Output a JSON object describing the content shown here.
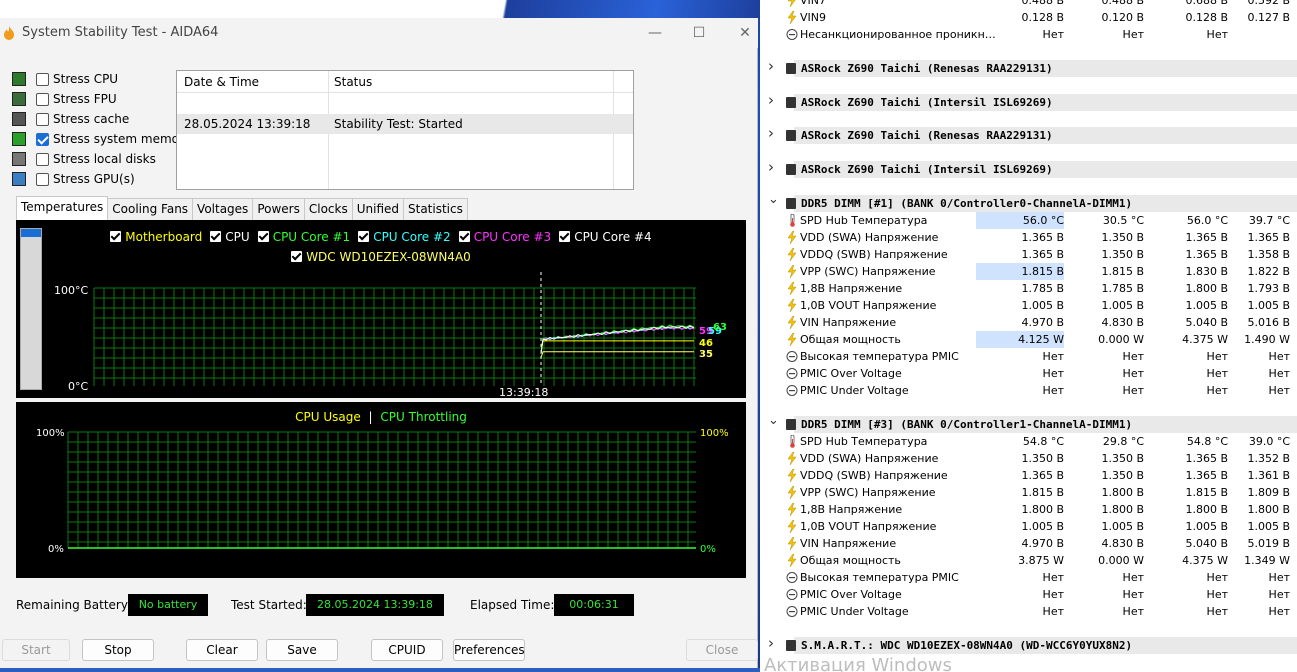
{
  "window": {
    "title": "System Stability Test - AIDA64",
    "minimize": "—",
    "maximize": "☐",
    "close": "✕"
  },
  "stress_options": [
    {
      "label": "Stress CPU",
      "checked": false
    },
    {
      "label": "Stress FPU",
      "checked": false
    },
    {
      "label": "Stress cache",
      "checked": false
    },
    {
      "label": "Stress system memory",
      "checked": true
    },
    {
      "label": "Stress local disks",
      "checked": false
    },
    {
      "label": "Stress GPU(s)",
      "checked": false
    }
  ],
  "log": {
    "headers": [
      "Date & Time",
      "Status"
    ],
    "rows": [
      {
        "datetime": "28.05.2024 13:39:18",
        "status": "Stability Test: Started"
      }
    ]
  },
  "tabs": [
    "Temperatures",
    "Cooling Fans",
    "Voltages",
    "Powers",
    "Clocks",
    "Unified",
    "Statistics"
  ],
  "temp_graph": {
    "legend": [
      {
        "label": "Motherboard",
        "color": "#ffff00"
      },
      {
        "label": "CPU",
        "color": "#ffffff"
      },
      {
        "label": "CPU Core #1",
        "color": "#33ff33"
      },
      {
        "label": "CPU Core #2",
        "color": "#33ffff"
      },
      {
        "label": "CPU Core #3",
        "color": "#ff33ff"
      },
      {
        "label": "CPU Core #4",
        "color": "#ffffff"
      },
      {
        "label": "WDC WD10EZEX-08WN4A0",
        "color": "#ffff66"
      }
    ],
    "y_top": "100°C",
    "y_bottom": "0°C",
    "x_marker": "13:39:18",
    "end_values": [
      {
        "v": "59",
        "color": "#ff33ff"
      },
      {
        "v": "59",
        "color": "#33ffff"
      },
      {
        "v": "63",
        "color": "#33ff33"
      },
      {
        "v": "46",
        "color": "#ffff00"
      },
      {
        "v": "35",
        "color": "#ffff66"
      }
    ]
  },
  "cpu_graph": {
    "legend_usage": "CPU Usage",
    "legend_sep": "|",
    "legend_throttle": "CPU Throttling",
    "left_top": "100%",
    "left_bottom": "0%",
    "right_top": "100%",
    "right_bottom": "0%"
  },
  "status_bar": {
    "battery_label": "Remaining Battery:",
    "battery_value": "No battery",
    "started_label": "Test Started:",
    "started_value": "28.05.2024 13:39:18",
    "elapsed_label": "Elapsed Time:",
    "elapsed_value": "00:06:31"
  },
  "buttons": {
    "start": "Start",
    "stop": "Stop",
    "clear": "Clear",
    "save": "Save",
    "cpuid": "CPUID",
    "preferences": "Preferences",
    "close": "Close"
  },
  "sensors": {
    "top_rows": [
      {
        "name": "VIN7",
        "icon": "volt",
        "v": [
          "0.488 В",
          "0.488 В",
          "0.688 В",
          "0.592 В"
        ]
      },
      {
        "name": "VIN9",
        "icon": "volt",
        "v": [
          "0.128 В",
          "0.120 В",
          "0.128 В",
          "0.127 В"
        ]
      },
      {
        "name": "Несанкционированное проникн…",
        "icon": "alert",
        "v": [
          "Нет",
          "Нет",
          "Нет",
          ""
        ]
      }
    ],
    "collapsed_groups": [
      "ASRock Z690 Taichi (Renesas RAA229131)",
      "ASRock Z690 Taichi (Intersil ISL69269)",
      "ASRock Z690 Taichi (Renesas RAA229131)",
      "ASRock Z690 Taichi (Intersil ISL69269)"
    ],
    "dimm1": {
      "title": "DDR5 DIMM [#1] (BANK 0/Controller0-ChannelA-DIMM1)",
      "rows": [
        {
          "name": "SPD Hub Температура",
          "icon": "temp",
          "v": [
            "56.0 °C",
            "30.5 °C",
            "56.0 °C",
            "39.7 °C"
          ],
          "hl": true
        },
        {
          "name": "VDD (SWA) Напряжение",
          "icon": "volt",
          "v": [
            "1.365 В",
            "1.350 В",
            "1.365 В",
            "1.365 В"
          ],
          "hl": false
        },
        {
          "name": "VDDQ (SWB) Напряжение",
          "icon": "volt",
          "v": [
            "1.365 В",
            "1.350 В",
            "1.365 В",
            "1.358 В"
          ],
          "hl": false
        },
        {
          "name": "VPP (SWC) Напряжение",
          "icon": "volt",
          "v": [
            "1.815 В",
            "1.815 В",
            "1.830 В",
            "1.822 В"
          ],
          "hl": true
        },
        {
          "name": "1,8В Напряжение",
          "icon": "volt",
          "v": [
            "1.785 В",
            "1.785 В",
            "1.800 В",
            "1.793 В"
          ],
          "hl": false
        },
        {
          "name": "1,0В VOUT Напряжение",
          "icon": "volt",
          "v": [
            "1.005 В",
            "1.005 В",
            "1.005 В",
            "1.005 В"
          ],
          "hl": false
        },
        {
          "name": "VIN Напряжение",
          "icon": "volt",
          "v": [
            "4.970 В",
            "4.830 В",
            "5.040 В",
            "5.016 В"
          ],
          "hl": false
        },
        {
          "name": "Общая мощность",
          "icon": "volt",
          "v": [
            "4.125 W",
            "0.000 W",
            "4.375 W",
            "1.490 W"
          ],
          "hl": true
        },
        {
          "name": "Высокая температура PMIC",
          "icon": "alert",
          "v": [
            "Нет",
            "Нет",
            "Нет",
            "Нет"
          ],
          "hl": false
        },
        {
          "name": "PMIC Over Voltage",
          "icon": "alert",
          "v": [
            "Нет",
            "Нет",
            "Нет",
            "Нет"
          ],
          "hl": false
        },
        {
          "name": "PMIC Under Voltage",
          "icon": "alert",
          "v": [
            "Нет",
            "Нет",
            "Нет",
            "Нет"
          ],
          "hl": false
        }
      ]
    },
    "dimm3": {
      "title": "DDR5 DIMM [#3] (BANK 0/Controller1-ChannelA-DIMM1)",
      "rows": [
        {
          "name": "SPD Hub Температура",
          "icon": "temp",
          "v": [
            "54.8 °C",
            "29.8 °C",
            "54.8 °C",
            "39.0 °C"
          ],
          "hl": false
        },
        {
          "name": "VDD (SWA) Напряжение",
          "icon": "volt",
          "v": [
            "1.350 В",
            "1.350 В",
            "1.365 В",
            "1.352 В"
          ],
          "hl": false
        },
        {
          "name": "VDDQ (SWB) Напряжение",
          "icon": "volt",
          "v": [
            "1.365 В",
            "1.350 В",
            "1.365 В",
            "1.361 В"
          ],
          "hl": false
        },
        {
          "name": "VPP (SWC) Напряжение",
          "icon": "volt",
          "v": [
            "1.815 В",
            "1.800 В",
            "1.815 В",
            "1.809 В"
          ],
          "hl": false
        },
        {
          "name": "1,8В Напряжение",
          "icon": "volt",
          "v": [
            "1.800 В",
            "1.800 В",
            "1.800 В",
            "1.800 В"
          ],
          "hl": false
        },
        {
          "name": "1,0В VOUT Напряжение",
          "icon": "volt",
          "v": [
            "1.005 В",
            "1.005 В",
            "1.005 В",
            "1.005 В"
          ],
          "hl": false
        },
        {
          "name": "VIN Напряжение",
          "icon": "volt",
          "v": [
            "4.970 В",
            "4.830 В",
            "5.040 В",
            "5.019 В"
          ],
          "hl": false
        },
        {
          "name": "Общая мощность",
          "icon": "volt",
          "v": [
            "3.875 W",
            "0.000 W",
            "4.375 W",
            "1.349 W"
          ],
          "hl": false
        },
        {
          "name": "Высокая температура PMIC",
          "icon": "alert",
          "v": [
            "Нет",
            "Нет",
            "Нет",
            "Нет"
          ],
          "hl": false
        },
        {
          "name": "PMIC Over Voltage",
          "icon": "alert",
          "v": [
            "Нет",
            "Нет",
            "Нет",
            "Нет"
          ],
          "hl": false
        },
        {
          "name": "PMIC Under Voltage",
          "icon": "alert",
          "v": [
            "Нет",
            "Нет",
            "Нет",
            "Нет"
          ],
          "hl": false
        }
      ]
    },
    "smart_group": "S.M.A.R.T.: WDC WD10EZEX-08WN4A0 (WD-WCC6Y0YUX8N2)"
  },
  "watermark": "Активация Windows"
}
